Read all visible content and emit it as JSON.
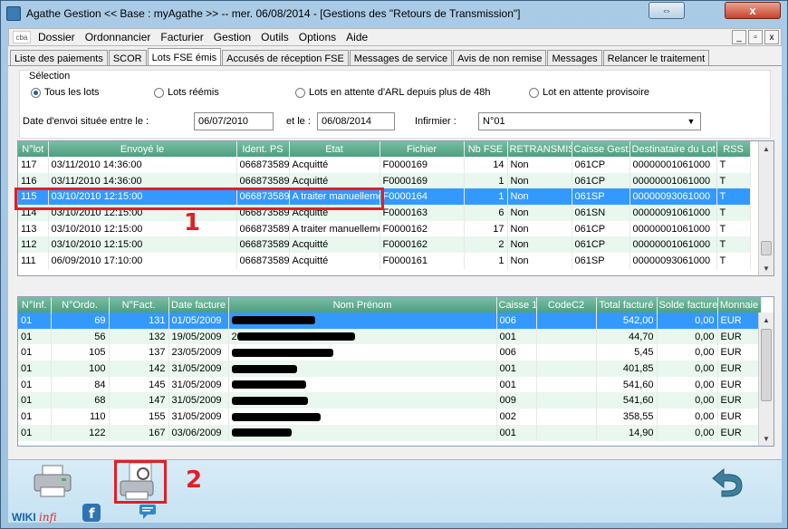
{
  "window": {
    "title": "Agathe Gestion << Base : myAgathe >>   --   mer. 06/08/2014  - [Gestions des \"Retours de Transmission\"]",
    "close_label": "x",
    "restore_label": "⇔"
  },
  "menu": {
    "logo": "cba",
    "items": [
      "Dossier",
      "Ordonnancier",
      "Facturier",
      "Gestion",
      "Outils",
      "Options",
      "Aide"
    ],
    "mdi": [
      "_",
      "▫",
      "x"
    ]
  },
  "tabs": [
    "Liste des paiements",
    "SCOR",
    "Lots FSE émis",
    "Accusés de réception FSE",
    "Messages de service",
    "Avis de non remise",
    "Messages",
    "Relancer le traitement"
  ],
  "active_tab": "Lots FSE émis",
  "selection": {
    "title": "Sélection",
    "options": [
      "Tous les lots",
      "Lots réémis",
      "Lots en attente d'ARL depuis plus de 48h",
      "Lot en attente provisoire"
    ],
    "selected": "Tous les lots",
    "date_label": "Date d'envoi située entre le :",
    "date_from": "06/07/2010",
    "and_label": "et le :",
    "date_to": "06/08/2014",
    "nurse_label": "Infirmier :",
    "nurse_value": "N°01"
  },
  "lots_table": {
    "columns": [
      "N°lot",
      "Envoyé le",
      "Ident. PS",
      "Etat",
      "Fichier",
      "Nb FSE",
      "RETRANSMIS",
      "Caisse Gest.",
      "Destinataire du Lot",
      "RSS"
    ],
    "rows": [
      [
        "117",
        "03/11/2010 14:36:00",
        "066873589",
        "Acquitté",
        "F0000169",
        "14",
        "Non",
        "061CP",
        "00000001061000",
        "T"
      ],
      [
        "116",
        "03/11/2010 14:36:00",
        "066873589",
        "Acquitté",
        "F0000169",
        "1",
        "Non",
        "061CP",
        "00000001061000",
        "T"
      ],
      [
        "115",
        "03/10/2010 12:15:00",
        "066873589",
        "A traiter manuellement",
        "F0000164",
        "1",
        "Non",
        "061SP",
        "00000093061000",
        "T"
      ],
      [
        "114",
        "03/10/2010 12:15:00",
        "066873589",
        "Acquitté",
        "F0000163",
        "6",
        "Non",
        "061SN",
        "00000091061000",
        "T"
      ],
      [
        "113",
        "03/10/2010 12:15:00",
        "066873589",
        "A traiter manuellement",
        "F0000162",
        "17",
        "Non",
        "061CP",
        "00000001061000",
        "T"
      ],
      [
        "112",
        "03/10/2010 12:15:00",
        "066873589",
        "Acquitté",
        "F0000162",
        "2",
        "Non",
        "061CP",
        "00000001061000",
        "T"
      ],
      [
        "111",
        "06/09/2010 17:10:00",
        "066873589",
        "Acquitté",
        "F0000161",
        "1",
        "Non",
        "061SP",
        "00000093061000",
        "T"
      ]
    ]
  },
  "fse_table": {
    "columns": [
      "N°Inf.",
      "N°Ordo.",
      "N°Fact.",
      "Date facture",
      "Nom Prénom",
      "Caisse 1",
      "CodeC2",
      "Total facturé",
      "Solde facture",
      "Monnaie"
    ],
    "rows": [
      [
        "01",
        "69",
        "131",
        "01/05/2009",
        "",
        "006",
        "",
        "542,00",
        "0,00",
        "EUR"
      ],
      [
        "01",
        "56",
        "132",
        "19/05/2009",
        "2",
        "001",
        "",
        "44,70",
        "0,00",
        "EUR"
      ],
      [
        "01",
        "105",
        "137",
        "23/05/2009",
        "",
        "006",
        "",
        "5,45",
        "0,00",
        "EUR"
      ],
      [
        "01",
        "100",
        "142",
        "31/05/2009",
        "",
        "001",
        "",
        "401,85",
        "0,00",
        "EUR"
      ],
      [
        "01",
        "84",
        "145",
        "31/05/2009",
        "",
        "001",
        "",
        "541,60",
        "0,00",
        "EUR"
      ],
      [
        "01",
        "68",
        "147",
        "31/05/2009",
        "",
        "009",
        "",
        "541,60",
        "0,00",
        "EUR"
      ],
      [
        "01",
        "110",
        "155",
        "31/05/2009",
        "",
        "002",
        "",
        "358,55",
        "0,00",
        "EUR"
      ],
      [
        "01",
        "122",
        "167",
        "03/06/2009",
        "",
        "001",
        "",
        "14,90",
        "0,00",
        "EUR"
      ]
    ]
  },
  "annotations": [
    "1",
    "2"
  ],
  "footer": {
    "wiki_a": "WIKI",
    "wiki_b": "infi",
    "icons": [
      "printer-icon",
      "print-lot-icon",
      "back-icon",
      "facebook-icon",
      "chat-icon"
    ]
  },
  "colors": {
    "header_green": "#4f9e80",
    "selection_blue": "#3399ff",
    "annotation_red": "#e21e26"
  }
}
